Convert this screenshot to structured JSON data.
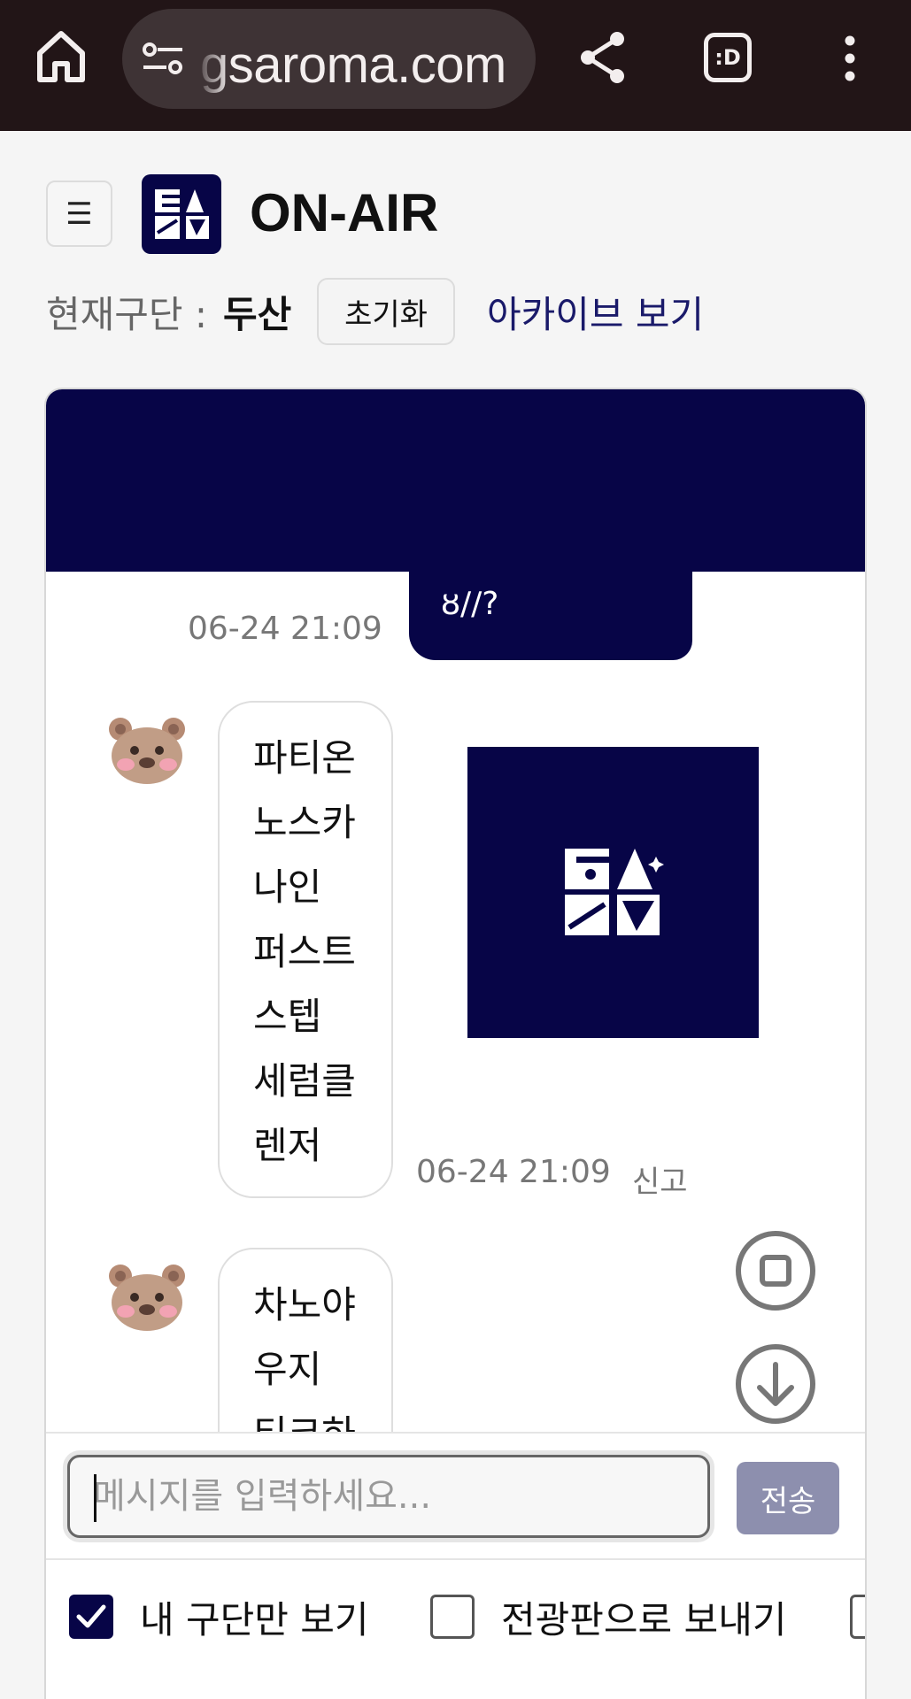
{
  "browser": {
    "url": "gsaroma.com"
  },
  "header": {
    "menu_icon": "☰",
    "title": "ON-AIR"
  },
  "section": {
    "label": "현재구단 :",
    "value": "두산",
    "reset_label": "초기화",
    "archive_label": "아카이브 보기"
  },
  "chat": {
    "mine": {
      "text": "ȣ//?",
      "timestamp": "06-24 21:09"
    },
    "messages": [
      {
        "lines": [
          "파티온",
          "노스카",
          "나인",
          "퍼스트",
          "스텝",
          "세럼클",
          "렌저"
        ],
        "timestamp": "06-24 21:09",
        "report_label": "신고"
      },
      {
        "lines": [
          "차노야",
          "우지",
          "티크하"
        ]
      }
    ]
  },
  "composer": {
    "placeholder": "메시지를 입력하세요...",
    "send_label": "전송"
  },
  "options": {
    "my_team_only": {
      "label": "내 구단만 보기",
      "checked": true
    },
    "send_to_board": {
      "label": "전광판으로 보내기",
      "checked": false
    }
  },
  "colors": {
    "brand_navy": "#070547",
    "browser_bar": "#221517",
    "send_button": "#8d8fae"
  }
}
